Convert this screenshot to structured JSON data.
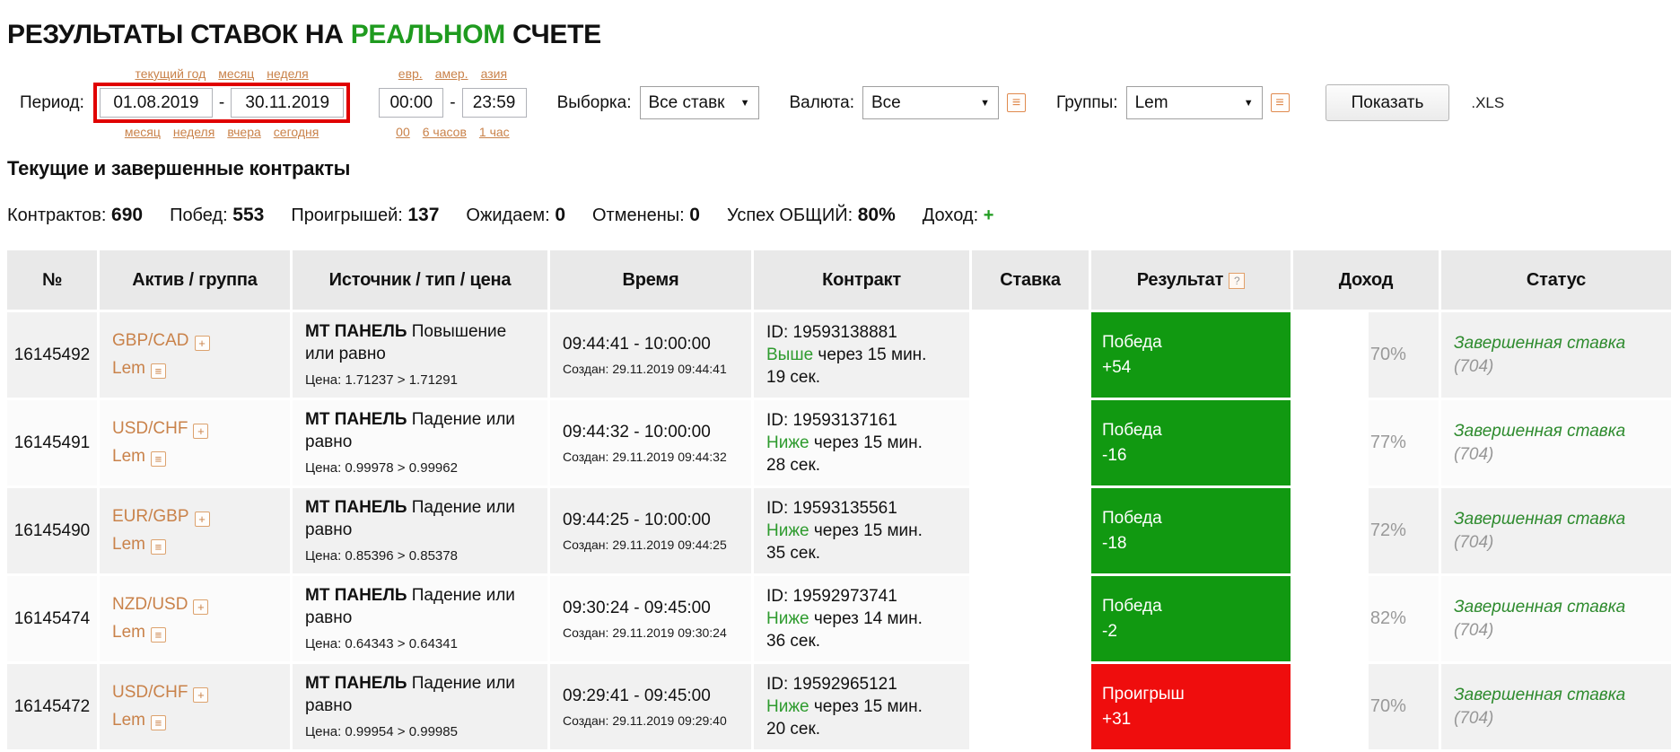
{
  "title": {
    "prefix": "РЕЗУЛЬТАТЫ СТАВОК НА ",
    "accent": "РЕАЛЬНОМ",
    "suffix": " СЧЕТЕ"
  },
  "colors": {
    "accent_green": "#1f9b1f",
    "result_win_green": "#119911",
    "result_loss_red": "#ef0d0d",
    "link_orange": "#c9824a",
    "highlight_border_red": "#e00000"
  },
  "filters": {
    "period_label": "Период:",
    "date_links_top": [
      "текущий год",
      "месяц",
      "неделя"
    ],
    "date_from": "01.08.2019",
    "date_to": "30.11.2019",
    "date_links_bottom": [
      "месяц",
      "неделя",
      "вчера",
      "сегодня"
    ],
    "time_links_top": [
      "евр.",
      "амер.",
      "азия"
    ],
    "time_from": "00:00",
    "time_to": "23:59",
    "time_links_bottom": [
      "00",
      "6 часов",
      "1 час"
    ],
    "selection_label": "Выборка:",
    "selection_value": "Все ставк",
    "currency_label": "Валюта:",
    "currency_value": "Все",
    "groups_label": "Группы:",
    "groups_value": "Lem",
    "show_button": "Показать",
    "xls_label": ".XLS"
  },
  "section_heading": "Текущие и завершенные контракты",
  "summary": {
    "items": [
      {
        "label": "Контрактов:",
        "value": "690"
      },
      {
        "label": "Побед:",
        "value": "553"
      },
      {
        "label": "Проигрышей:",
        "value": "137"
      },
      {
        "label": "Ожидаем:",
        "value": "0"
      },
      {
        "label": "Отменены:",
        "value": "0"
      },
      {
        "label": "Успех ОБЩИЙ:",
        "value": "80%"
      }
    ],
    "profit_label": "Доход:",
    "profit_value": "+"
  },
  "table": {
    "headers": [
      "№",
      "Актив / группа",
      "Источник / тип / цена",
      "Время",
      "Контракт",
      "Ставка",
      "Результат",
      "Доход",
      "Статус"
    ],
    "help_icon": "?",
    "rows": [
      {
        "num": "16145492",
        "asset": "GBP/CAD",
        "group": "Lem",
        "source": "МТ ПАНЕЛЬ",
        "type": "Повышение или равно",
        "price": "Цена: 1.71237 > 1.71291",
        "time_range": "09:44:41 - 10:00:00",
        "created": "Создан: 29.11.2019 09:44:41",
        "id": "ID: 19593138881",
        "direction": "Выше",
        "direction_rest": "через 15 мин.",
        "duration": "19 сек.",
        "result_label": "Победа",
        "result_value": "+54",
        "result_type": "win",
        "income_pct": "70%",
        "status": "Завершенная ставка",
        "status_code": "(704)"
      },
      {
        "num": "16145491",
        "asset": "USD/CHF",
        "group": "Lem",
        "source": "МТ ПАНЕЛЬ",
        "type": "Падение или равно",
        "price": "Цена: 0.99978 > 0.99962",
        "time_range": "09:44:32 - 10:00:00",
        "created": "Создан: 29.11.2019 09:44:32",
        "id": "ID: 19593137161",
        "direction": "Ниже",
        "direction_rest": "через 15 мин.",
        "duration": "28 сек.",
        "result_label": "Победа",
        "result_value": "-16",
        "result_type": "win",
        "income_pct": "77%",
        "status": "Завершенная ставка",
        "status_code": "(704)"
      },
      {
        "num": "16145490",
        "asset": "EUR/GBP",
        "group": "Lem",
        "source": "МТ ПАНЕЛЬ",
        "type": "Падение или равно",
        "price": "Цена: 0.85396 > 0.85378",
        "time_range": "09:44:25 - 10:00:00",
        "created": "Создан: 29.11.2019 09:44:25",
        "id": "ID: 19593135561",
        "direction": "Ниже",
        "direction_rest": "через 15 мин.",
        "duration": "35 сек.",
        "result_label": "Победа",
        "result_value": "-18",
        "result_type": "win",
        "income_pct": "72%",
        "status": "Завершенная ставка",
        "status_code": "(704)"
      },
      {
        "num": "16145474",
        "asset": "NZD/USD",
        "group": "Lem",
        "source": "МТ ПАНЕЛЬ",
        "type": "Падение или равно",
        "price": "Цена: 0.64343 > 0.64341",
        "time_range": "09:30:24 - 09:45:00",
        "created": "Создан: 29.11.2019 09:30:24",
        "id": "ID: 19592973741",
        "direction": "Ниже",
        "direction_rest": "через 14 мин.",
        "duration": "36 сек.",
        "result_label": "Победа",
        "result_value": "-2",
        "result_type": "win",
        "income_pct": "82%",
        "status": "Завершенная ставка",
        "status_code": "(704)"
      },
      {
        "num": "16145472",
        "asset": "USD/CHF",
        "group": "Lem",
        "source": "МТ ПАНЕЛЬ",
        "type": "Падение или равно",
        "price": "Цена: 0.99954 > 0.99985",
        "time_range": "09:29:41 - 09:45:00",
        "created": "Создан: 29.11.2019 09:29:40",
        "id": "ID: 19592965121",
        "direction": "Ниже",
        "direction_rest": "через 15 мин.",
        "duration": "20 сек.",
        "result_label": "Проигрыш",
        "result_value": "+31",
        "result_type": "loss",
        "income_pct": "70%",
        "status": "Завершенная ставка",
        "status_code": "(704)"
      }
    ]
  }
}
